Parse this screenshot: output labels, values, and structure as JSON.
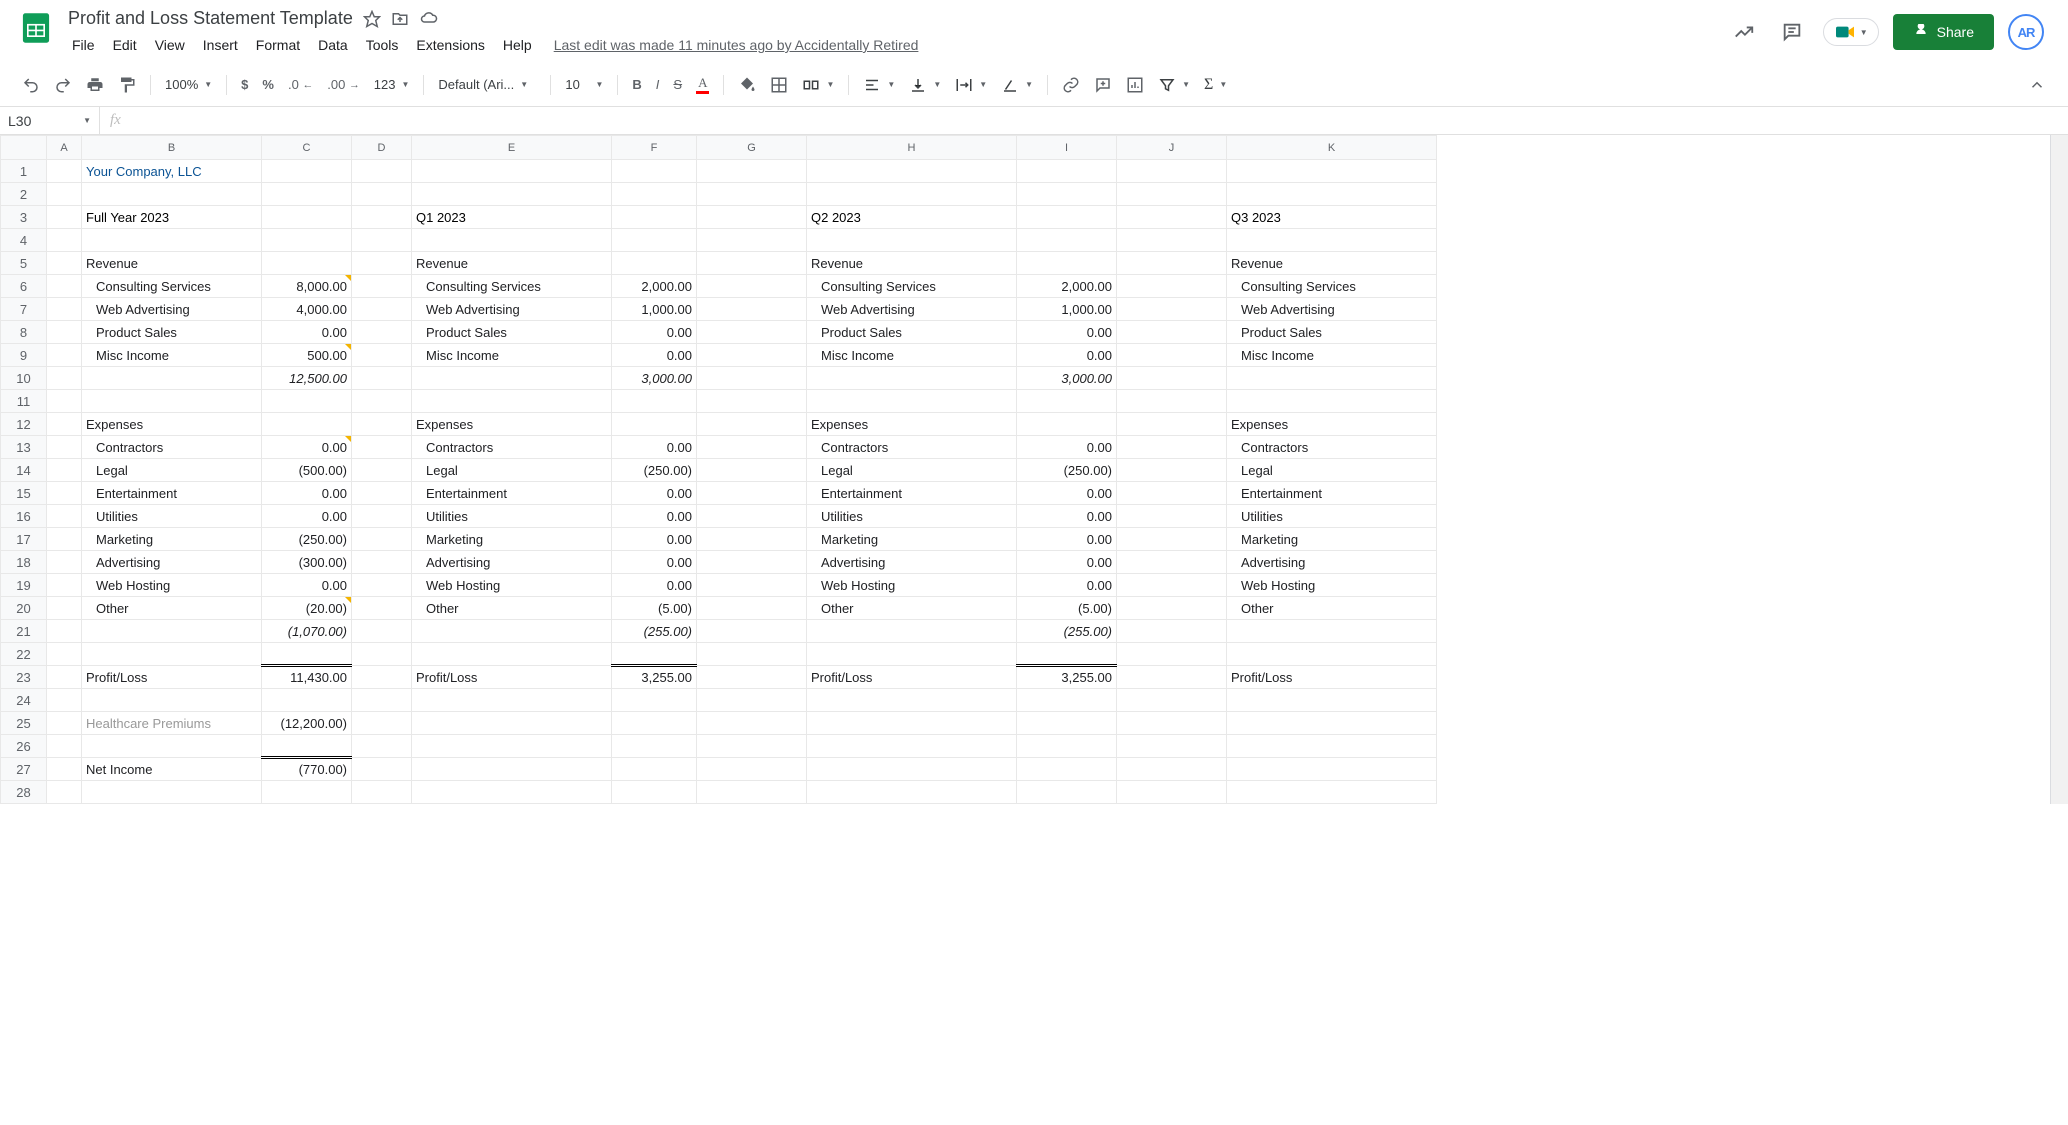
{
  "doc": {
    "title": "Profit and Loss Statement Template"
  },
  "menus": [
    "File",
    "Edit",
    "View",
    "Insert",
    "Format",
    "Data",
    "Tools",
    "Extensions",
    "Help"
  ],
  "last_edit": "Last edit was made 11 minutes ago by Accidentally Retired",
  "share_label": "Share",
  "avatar_initials": "AR",
  "toolbar": {
    "zoom": "100%",
    "number_format": "123",
    "font": "Default (Ari...",
    "font_size": "10"
  },
  "name_box": "L30",
  "formula": "",
  "columns": [
    "A",
    "B",
    "C",
    "D",
    "E",
    "F",
    "G",
    "H",
    "I",
    "J",
    "K"
  ],
  "row_count": 28,
  "company": "Your Company, LLC",
  "periods": {
    "full": "Full Year 2023",
    "q1": "Q1 2023",
    "q2": "Q2 2023",
    "q3": "Q3 2023"
  },
  "labels": {
    "revenue": "Revenue",
    "expenses": "Expenses",
    "profit_loss": "Profit/Loss",
    "healthcare": "Healthcare Premiums",
    "net_income": "Net Income"
  },
  "rev_items": [
    "Consulting Services",
    "Web Advertising",
    "Product Sales",
    "Misc Income"
  ],
  "exp_items": [
    "Contractors",
    "Legal",
    "Entertainment",
    "Utilities",
    "Marketing",
    "Advertising",
    "Web Hosting",
    "Other"
  ],
  "vals": {
    "full": {
      "rev": [
        "8,000.00",
        "4,000.00",
        "0.00",
        "500.00"
      ],
      "rev_total": "12,500.00",
      "exp": [
        "0.00",
        "(500.00)",
        "0.00",
        "0.00",
        "(250.00)",
        "(300.00)",
        "0.00",
        "(20.00)"
      ],
      "exp_total": "(1,070.00)",
      "profit": "11,430.00",
      "healthcare": "(12,200.00)",
      "net": "(770.00)"
    },
    "q1": {
      "rev": [
        "2,000.00",
        "1,000.00",
        "0.00",
        "0.00"
      ],
      "rev_total": "3,000.00",
      "exp": [
        "0.00",
        "(250.00)",
        "0.00",
        "0.00",
        "0.00",
        "0.00",
        "0.00",
        "(5.00)"
      ],
      "exp_total": "(255.00)",
      "profit": "3,255.00"
    },
    "q2": {
      "rev": [
        "2,000.00",
        "1,000.00",
        "0.00",
        "0.00"
      ],
      "rev_total": "3,000.00",
      "exp": [
        "0.00",
        "(250.00)",
        "0.00",
        "0.00",
        "0.00",
        "0.00",
        "0.00",
        "(5.00)"
      ],
      "exp_total": "(255.00)",
      "profit": "3,255.00"
    }
  }
}
